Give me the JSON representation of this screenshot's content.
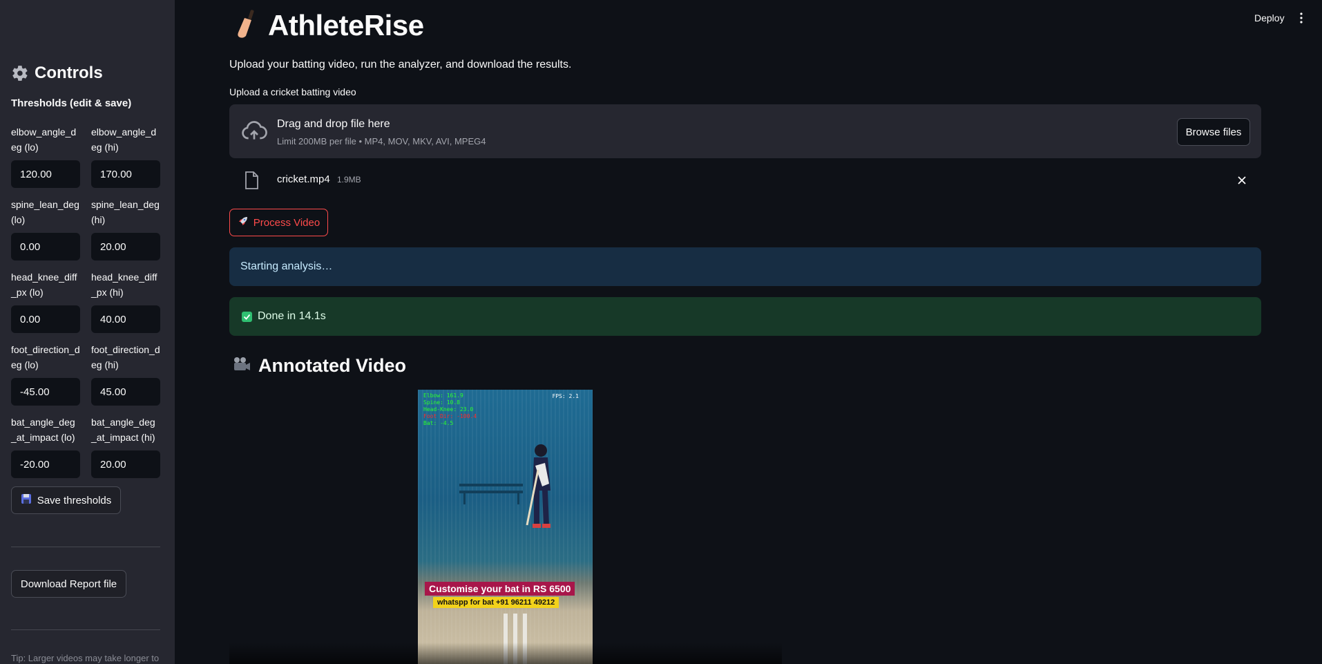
{
  "header": {
    "deploy_label": "Deploy"
  },
  "sidebar": {
    "title": "Controls",
    "subtitle": "Thresholds (edit & save)",
    "fields": [
      {
        "label": "elbow_angle_deg (lo)",
        "value": "120.00"
      },
      {
        "label": "elbow_angle_deg (hi)",
        "value": "170.00"
      },
      {
        "label": "spine_lean_deg (lo)",
        "value": "0.00"
      },
      {
        "label": "spine_lean_deg (hi)",
        "value": "20.00"
      },
      {
        "label": "head_knee_diff_px (lo)",
        "value": "0.00"
      },
      {
        "label": "head_knee_diff_px (hi)",
        "value": "40.00"
      },
      {
        "label": "foot_direction_deg (lo)",
        "value": "-45.00"
      },
      {
        "label": "foot_direction_deg (hi)",
        "value": "45.00"
      },
      {
        "label": "bat_angle_deg_at_impact (lo)",
        "value": "-20.00"
      },
      {
        "label": "bat_angle_deg_at_impact (hi)",
        "value": "20.00"
      }
    ],
    "save_label": "Save thresholds",
    "download_label": "Download Report file",
    "tip": "Tip: Larger videos may take longer to"
  },
  "main": {
    "title": "AthleteRise",
    "caption": "Upload your batting video, run the analyzer, and download the results.",
    "upload_label": "Upload a cricket batting video",
    "dropzone": {
      "main": "Drag and drop file here",
      "sub": "Limit 200MB per file • MP4, MOV, MKV, AVI, MPEG4",
      "browse": "Browse files"
    },
    "file": {
      "name": "cricket.mp4",
      "size": "1.9MB"
    },
    "process_label": "Process Video",
    "info_text": "Starting analysis…",
    "success_text": "Done in 14.1s",
    "section_title": "Annotated Video",
    "video": {
      "overlay": [
        {
          "text": "Elbow: 161.9",
          "color": "#2cff2c"
        },
        {
          "text": "Spine: 10.8",
          "color": "#2cff2c"
        },
        {
          "text": "Head-Knee: 23.0",
          "color": "#2cff2c"
        },
        {
          "text": "Foot Dir: -100.4",
          "color": "#ff2a2a"
        },
        {
          "text": "Bat: -4.5",
          "color": "#2cff2c"
        }
      ],
      "fps": "FPS: 2.1",
      "promo_line1": "Customise your bat in RS 6500",
      "promo_line2": "whatspp for bat +91 96211 49212"
    }
  }
}
